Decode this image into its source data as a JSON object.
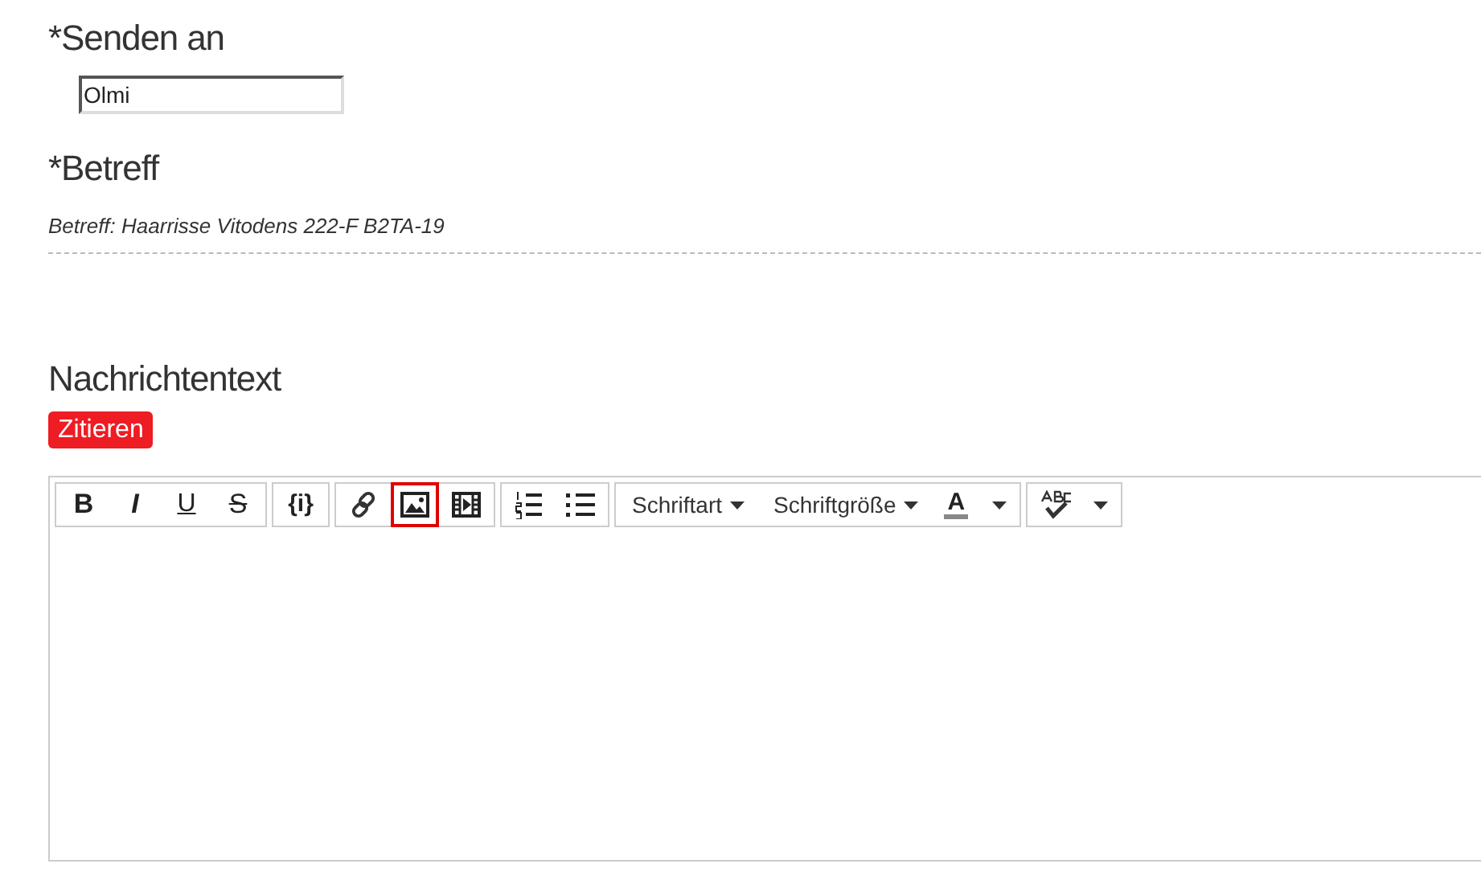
{
  "recipient": {
    "label": "*Senden an",
    "value": "Olmi"
  },
  "subject": {
    "label": "*Betreff",
    "value": "Betreff: Haarrisse Vitodens 222-F B2TA-19"
  },
  "message": {
    "label": "Nachrichtentext",
    "quote_button": "Zitieren"
  },
  "toolbar": [
    {
      "buttons": [
        {
          "kind": "bold",
          "text": "B",
          "highlighted": false
        },
        {
          "kind": "italic",
          "text": "I",
          "highlighted": false
        },
        {
          "kind": "underline",
          "text": "U",
          "highlighted": false
        },
        {
          "kind": "strike",
          "text": "S",
          "highlighted": false
        }
      ]
    },
    {
      "buttons": [
        {
          "kind": "code",
          "text": "{i}",
          "highlighted": false
        }
      ]
    },
    {
      "buttons": [
        {
          "kind": "link",
          "highlighted": false
        },
        {
          "kind": "image",
          "highlighted": true
        },
        {
          "kind": "video",
          "highlighted": false
        }
      ]
    },
    {
      "buttons": [
        {
          "kind": "numbered",
          "highlighted": false
        },
        {
          "kind": "bulleted",
          "highlighted": false
        }
      ]
    },
    {
      "buttons": [
        {
          "kind": "dropdown",
          "text": "Schriftart",
          "highlighted": false
        },
        {
          "kind": "dropdown",
          "text": "Schriftgröße",
          "highlighted": false
        },
        {
          "kind": "color",
          "text": "A",
          "highlighted": false
        }
      ]
    },
    {
      "buttons": [
        {
          "kind": "spellcheck",
          "highlighted": false
        }
      ]
    }
  ]
}
